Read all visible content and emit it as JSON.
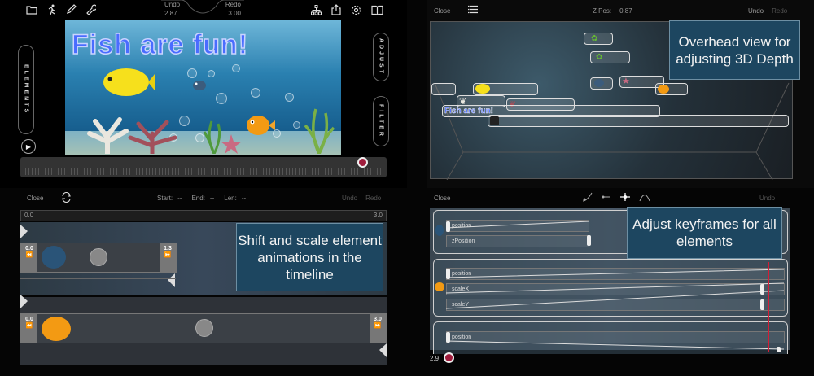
{
  "q1": {
    "undo_label": "Undo",
    "undo_value": "2.87",
    "redo_label": "Redo",
    "redo_value": "3.00",
    "stage_title": "Fish are fun!",
    "left_tab": "ELEMENTS",
    "right_tab_top": "ADJUST",
    "right_tab_bottom": "FILTER",
    "icons": [
      "folder-icon",
      "runner-icon",
      "pencil-icon",
      "wrench-icon",
      "hierarchy-icon",
      "share-icon",
      "gear-icon",
      "book-icon"
    ]
  },
  "q2": {
    "close_label": "Close",
    "zpos_label": "Z Pos:",
    "zpos_value": "0.87",
    "undo_label": "Undo",
    "redo_label": "Redo",
    "fish_label": "Fish are fun!",
    "caption": "Overhead view for adjusting 3D Depth"
  },
  "q3": {
    "close_label": "Close",
    "start_label": "Start:",
    "start_value": "--",
    "end_label": "End:",
    "end_value": "--",
    "len_label": "Len:",
    "len_value": "--",
    "undo_label": "Undo",
    "redo_label": "Redo",
    "ruler_start": "0.0",
    "ruler_end": "3.0",
    "clip1_start": "0.0",
    "clip1_end": "1.3",
    "clip2_start": "0.0",
    "clip2_end": "3.0",
    "caption": "Shift and scale element animations in the timeline"
  },
  "q4": {
    "close_label": "Close",
    "undo_label": "Undo",
    "caption": "Adjust keyframes for all elements",
    "group1_rows": [
      "position",
      "zPosition"
    ],
    "group2_rows": [
      "position",
      "scaleX",
      "scaleY"
    ],
    "group3_rows": [
      "position"
    ],
    "time_value": "2.9"
  },
  "colors": {
    "record": "#a01c3c",
    "caption_bg": "#1d4660",
    "title_blue": "#4a6cff"
  }
}
